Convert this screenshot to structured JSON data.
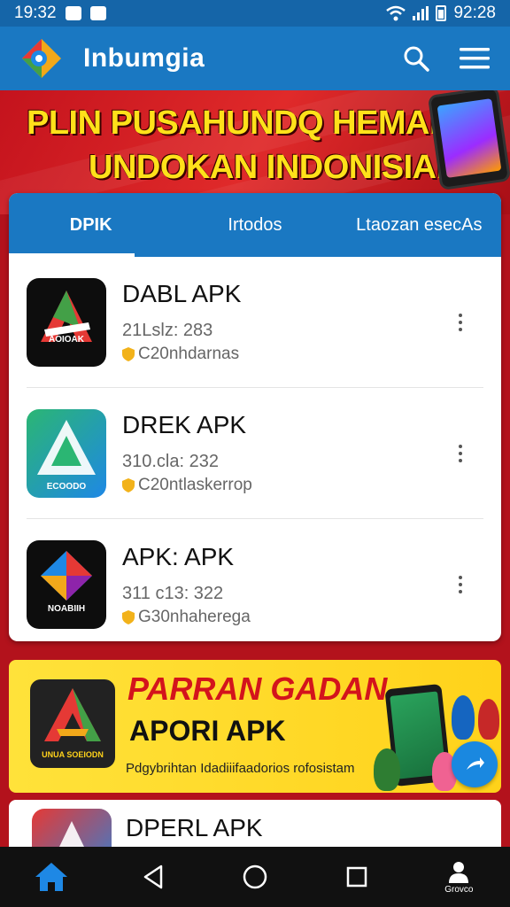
{
  "status_bar": {
    "time_left": "19:32",
    "time_right": "92:28"
  },
  "app_bar": {
    "title": "Inbumgia",
    "icons": [
      "app-logo-icon",
      "search-icon",
      "menu-icon"
    ]
  },
  "banner": {
    "line1": "PLIN PUSAHUNDQ HEMAN",
    "line2": "UNDOKAN INDONISIAI"
  },
  "tabs": [
    {
      "label": "DPIK",
      "active": true
    },
    {
      "label": "Irtodos",
      "active": false
    },
    {
      "label": "Ltaozan esecAs",
      "active": false
    }
  ],
  "apps": [
    {
      "name": "DABL APK",
      "meta": "21Lslz: 283",
      "developer": "C20nhdarnas",
      "icon_text": "AOIOAK"
    },
    {
      "name": "DREK APK",
      "meta": "310.cla: 232",
      "developer": "C20ntlaskerrop",
      "icon_text": "ECOODO"
    },
    {
      "name": "APK: APK",
      "meta": "311 c13: 322",
      "developer": "G30nhaherega",
      "icon_text": "NOABIIH"
    }
  ],
  "promo": {
    "title": "PARRAN GADAN",
    "subtitle": "APORI APK",
    "description": "Pdgybrihtan Idadiiifaadorios rofosistam",
    "icon_text": "UNUA SOEIODN"
  },
  "partial_app": {
    "name": "DPERL APK"
  },
  "nav": {
    "profile_label": "Grovco"
  },
  "colors": {
    "primary_blue": "#1a78c2",
    "banner_red": "#c4131d",
    "banner_yellow": "#ffe11a",
    "promo_yellow": "#ffd21a"
  }
}
